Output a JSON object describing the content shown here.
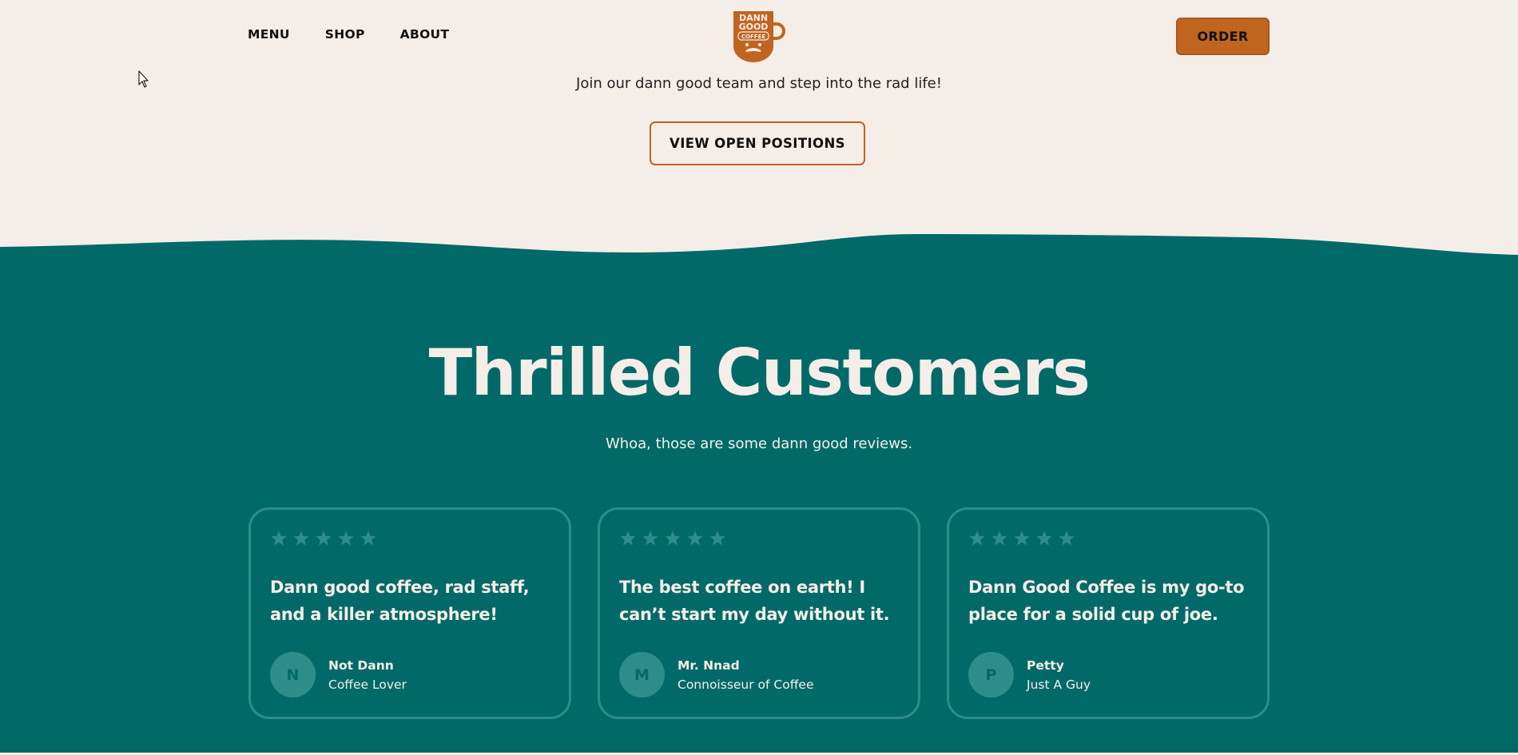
{
  "nav": {
    "items": [
      {
        "label": "MENU"
      },
      {
        "label": "SHOP"
      },
      {
        "label": "ABOUT"
      }
    ],
    "logo": {
      "line1": "DANN",
      "line2": "GOOD",
      "line3": "COFFEE"
    },
    "order_label": "ORDER"
  },
  "careers": {
    "tagline": "Join our dann good team and step into the rad life!",
    "button_label": "VIEW OPEN POSITIONS"
  },
  "reviews": {
    "title": "Thrilled Customers",
    "subtitle": "Whoa, those are some dann good reviews.",
    "cards": [
      {
        "stars": 5,
        "quote": "Dann good coffee, rad staff, and a killer atmosphere!",
        "initial": "N",
        "name": "Not Dann",
        "role": "Coffee Lover"
      },
      {
        "stars": 5,
        "quote": "The best coffee on earth! I can’t start my day without it.",
        "initial": "M",
        "name": "Mr. Nnad",
        "role": "Connoisseur of Coffee"
      },
      {
        "stars": 5,
        "quote": "Dann Good Coffee is my go-to place for a solid cup of joe.",
        "initial": "P",
        "name": "Petty",
        "role": "Just A Guy"
      }
    ]
  },
  "colors": {
    "background": "#f5ede8",
    "teal": "#016a68",
    "teal_light": "#2e8d89",
    "accent": "#c0651f"
  },
  "icons": {
    "cursor": "mouse-pointer-icon",
    "star": "star-icon"
  }
}
